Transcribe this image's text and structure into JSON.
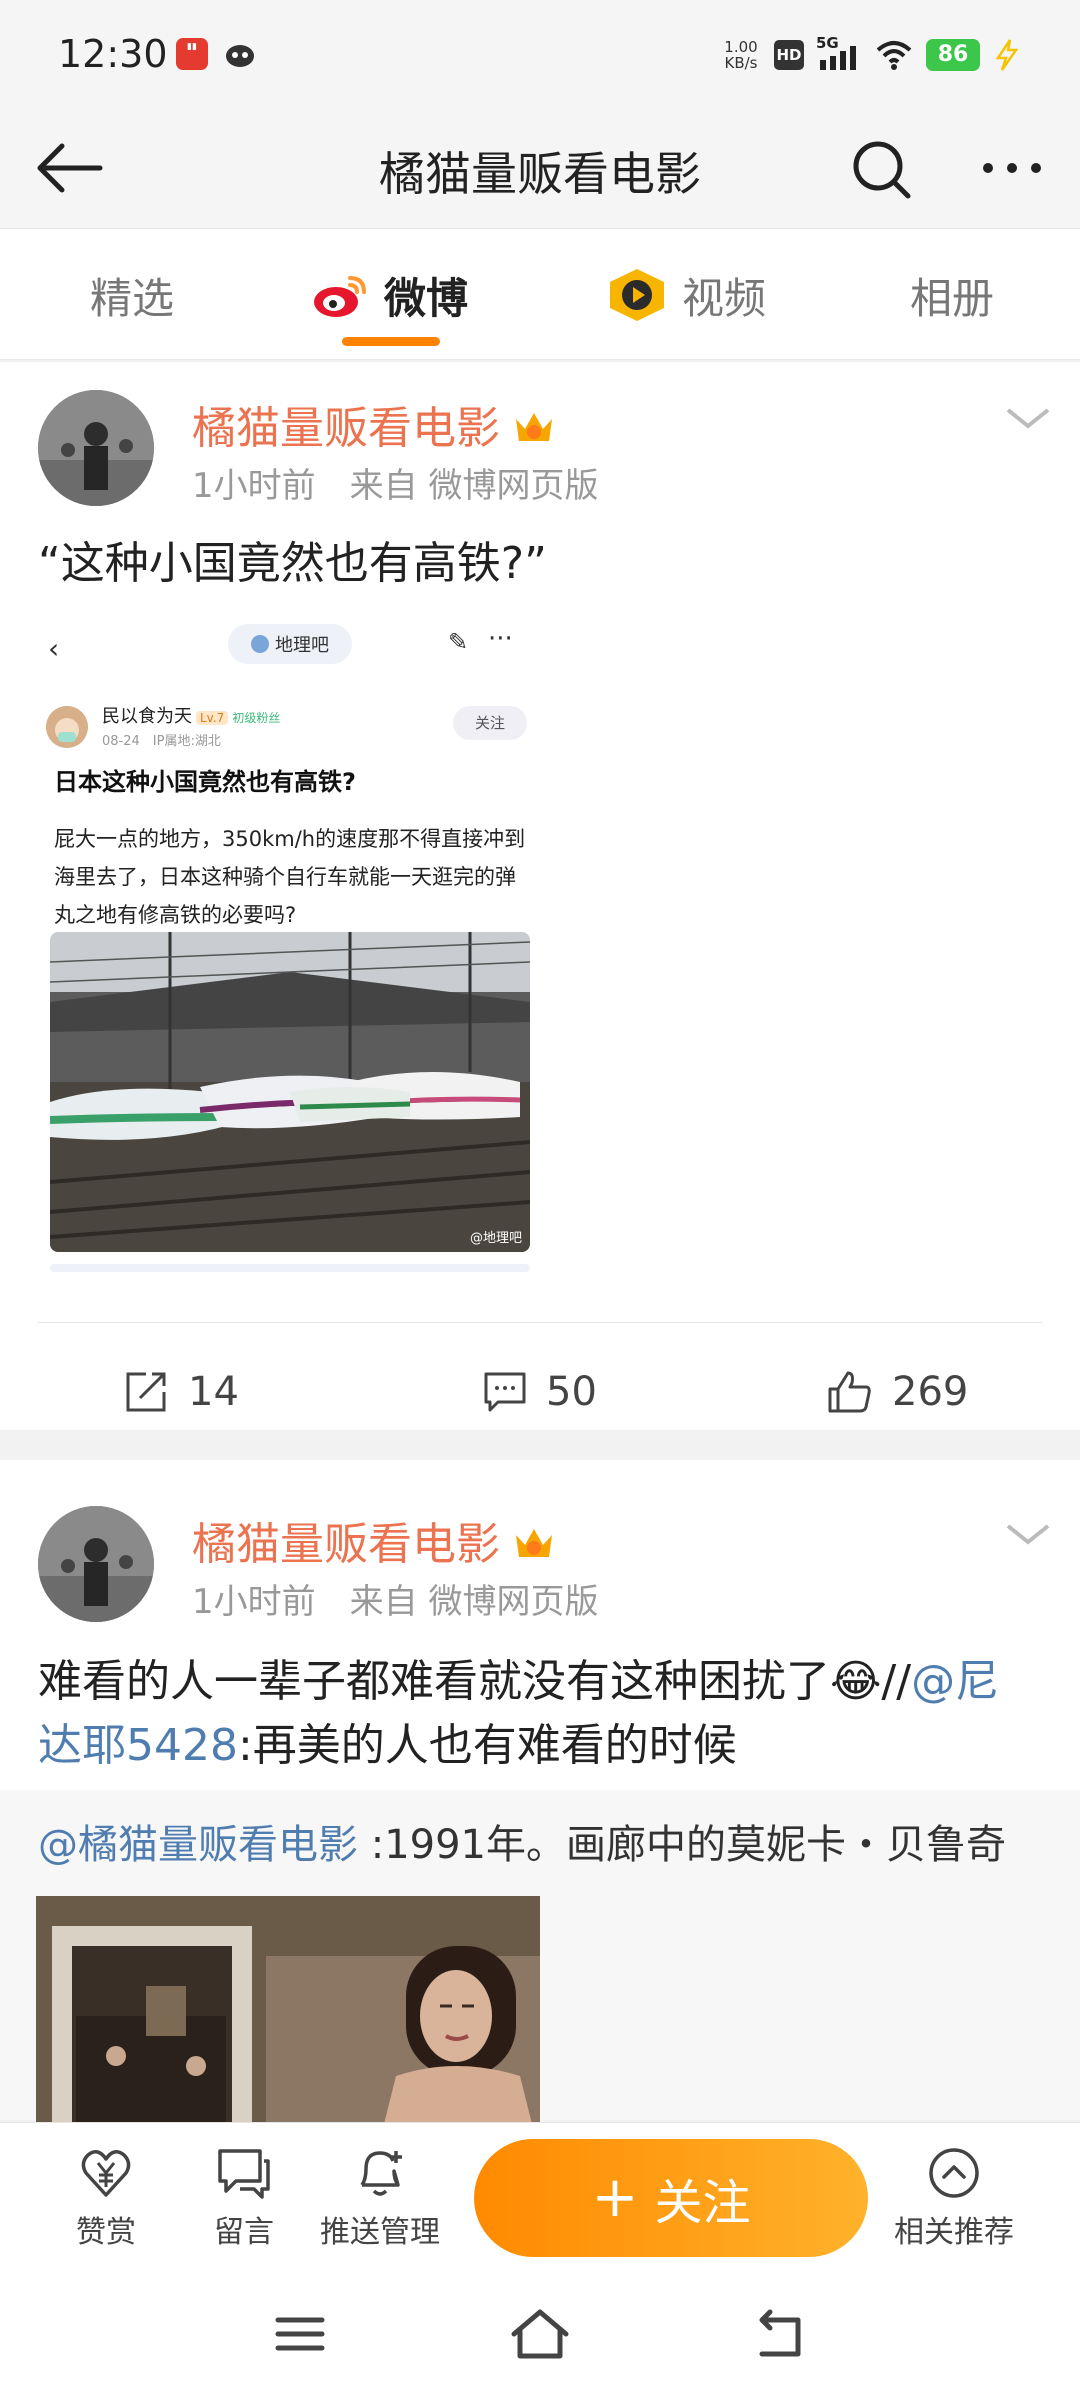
{
  "status": {
    "time": "12:30",
    "net_speed_value": "1.00",
    "net_speed_unit": "KB/s",
    "hd": "HD",
    "network": "5G",
    "battery": "86"
  },
  "header": {
    "title": "橘猫量贩看电影"
  },
  "tabs": [
    {
      "label": "精选"
    },
    {
      "label": "微博"
    },
    {
      "label": "视频"
    },
    {
      "label": "相册"
    }
  ],
  "posts": [
    {
      "username": "橘猫量贩看电影",
      "meta": "1小时前　来自 微博网页版",
      "text": "“这种小国竟然也有高铁?”",
      "embed": {
        "back": "‹",
        "forum": "地理吧",
        "user": "民以食为天",
        "level": "Lv.7",
        "fan": "初级粉丝",
        "date": "08-24　IP属地:湖北",
        "follow": "关注",
        "title": "日本这种小国竟然也有高铁?",
        "body": "屁大一点的地方，350km/h的速度那不得直接冲到海里去了，日本这种骑个自行车就能一天逛完的弹丸之地有修高铁的必要吗?",
        "watermark": "@地理吧"
      },
      "reposts": "14",
      "comments": "50",
      "likes": "269"
    },
    {
      "username": "橘猫量贩看电影",
      "meta": "1小时前　来自 微博网页版",
      "text_main": "难看的人一辈子都难看就没有这种困扰了😂//",
      "mention": "@尼达耶5428",
      "text_rest": ":再美的人也有难看的时候",
      "retweet_user": "@橘猫量贩看电影",
      "retweet_text": " :1991年。画廊中的莫妮卡・贝鲁奇"
    }
  ],
  "bottom_bar": {
    "tip": "赞赏",
    "message": "留言",
    "push": "推送管理",
    "follow": "关注",
    "related": "相关推荐"
  },
  "colors": {
    "accent": "#ff8200",
    "username": "#eb7350",
    "link": "#507daf"
  }
}
